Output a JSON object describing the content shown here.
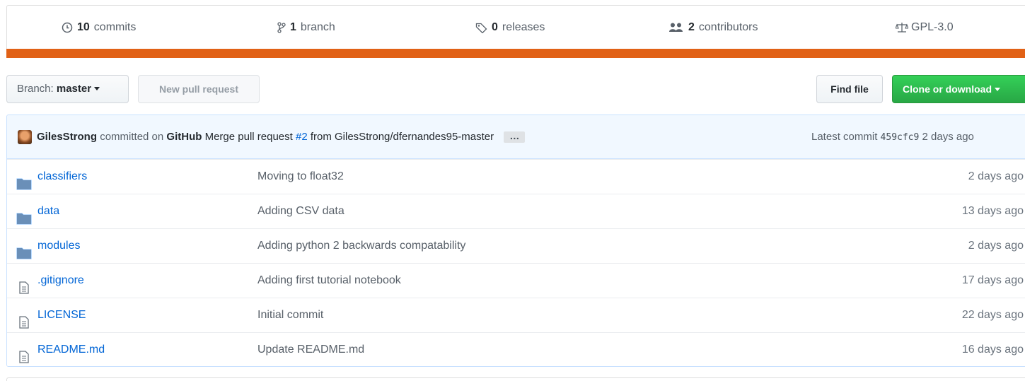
{
  "summary": {
    "commits": {
      "count": "10",
      "label": "commits",
      "icon": "history-icon"
    },
    "branches": {
      "count": "1",
      "label": "branch",
      "icon": "git-branch-icon"
    },
    "releases": {
      "count": "0",
      "label": "releases",
      "icon": "tag-icon"
    },
    "contributors": {
      "count": "2",
      "label": "contributors",
      "icon": "people-icon"
    },
    "license": {
      "label": "GPL-3.0",
      "icon": "law-icon"
    }
  },
  "language_colors": {
    "primary": "#e16116",
    "secondary": "#3572a5"
  },
  "toolbar": {
    "branch_prefix": "Branch:",
    "branch_name": "master",
    "new_pull_request": "New pull request",
    "find_file": "Find file",
    "clone_or_download": "Clone or download"
  },
  "latest_commit": {
    "author": "GilesStrong",
    "committed_on": "committed on",
    "platform": "GitHub",
    "message_prefix": "Merge pull request",
    "pr_link": "#2",
    "message_suffix": "from GilesStrong/dfernandes95-master",
    "ellipsis": "…",
    "latest_label": "Latest commit",
    "sha": "459cfc9",
    "age": "2 days ago"
  },
  "files": [
    {
      "type": "dir",
      "name": "classifiers",
      "message": "Moving to float32",
      "age": "2 days ago"
    },
    {
      "type": "dir",
      "name": "data",
      "message": "Adding CSV data",
      "age": "13 days ago"
    },
    {
      "type": "dir",
      "name": "modules",
      "message": "Adding python 2 backwards compatability",
      "age": "2 days ago"
    },
    {
      "type": "file",
      "name": ".gitignore",
      "message": "Adding first tutorial notebook",
      "age": "17 days ago"
    },
    {
      "type": "file",
      "name": "LICENSE",
      "message": "Initial commit",
      "age": "22 days ago"
    },
    {
      "type": "file",
      "name": "README.md",
      "message": "Update README.md",
      "age": "16 days ago"
    }
  ]
}
